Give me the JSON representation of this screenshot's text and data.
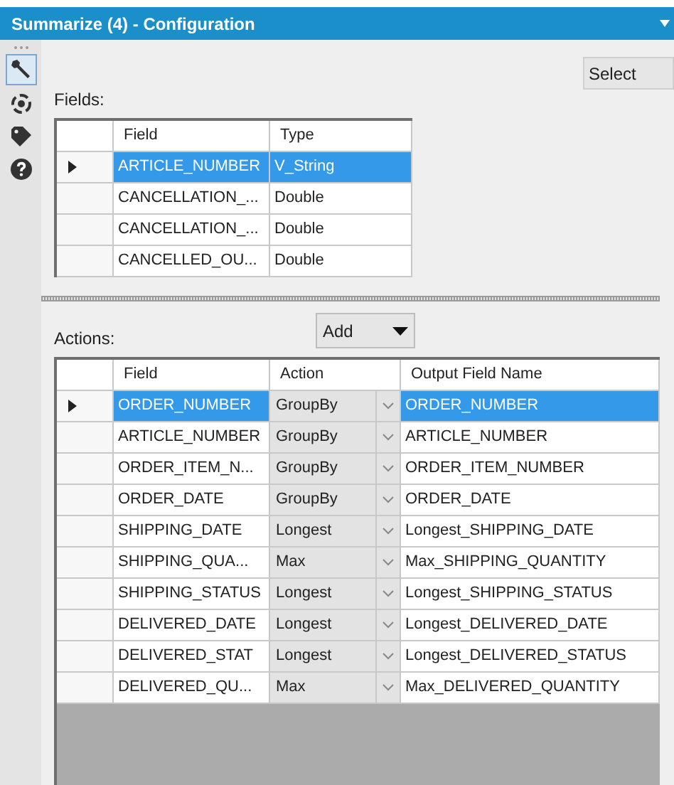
{
  "window": {
    "title": "Summarize (4) - Configuration"
  },
  "toolbar": [
    {
      "kind": "wrench",
      "selected": true
    },
    {
      "kind": "target",
      "selected": false
    },
    {
      "kind": "tag",
      "selected": false
    },
    {
      "kind": "help",
      "selected": false
    }
  ],
  "select_button": {
    "label": "Select"
  },
  "fields": {
    "label": "Fields:",
    "columns": [
      "Field",
      "Type"
    ],
    "rows": [
      {
        "field": "ARTICLE_NUMBER",
        "type": "V_String",
        "selected": true
      },
      {
        "field": "CANCELLATION_...",
        "type": "Double",
        "selected": false
      },
      {
        "field": "CANCELLATION_...",
        "type": "Double",
        "selected": false
      },
      {
        "field": "CANCELLED_OU...",
        "type": "Double",
        "selected": false
      }
    ]
  },
  "actions": {
    "label": "Actions:",
    "add_button": {
      "label": "Add"
    },
    "columns": [
      "Field",
      "Action",
      "Output Field Name"
    ],
    "rows": [
      {
        "field": "ORDER_NUMBER",
        "action": "GroupBy",
        "output": "ORDER_NUMBER",
        "selected": true
      },
      {
        "field": "ARTICLE_NUMBER",
        "action": "GroupBy",
        "output": "ARTICLE_NUMBER",
        "selected": false
      },
      {
        "field": "ORDER_ITEM_N...",
        "action": "GroupBy",
        "output": "ORDER_ITEM_NUMBER",
        "selected": false
      },
      {
        "field": "ORDER_DATE",
        "action": "GroupBy",
        "output": "ORDER_DATE",
        "selected": false
      },
      {
        "field": "SHIPPING_DATE",
        "action": "Longest",
        "output": "Longest_SHIPPING_DATE",
        "selected": false
      },
      {
        "field": "SHIPPING_QUA...",
        "action": "Max",
        "output": "Max_SHIPPING_QUANTITY",
        "selected": false
      },
      {
        "field": "SHIPPING_STATUS",
        "action": "Longest",
        "output": "Longest_SHIPPING_STATUS",
        "selected": false
      },
      {
        "field": "DELIVERED_DATE",
        "action": "Longest",
        "output": "Longest_DELIVERED_DATE",
        "selected": false
      },
      {
        "field": "DELIVERED_STAT",
        "action": "Longest",
        "output": "Longest_DELIVERED_STATUS",
        "selected": false
      },
      {
        "field": "DELIVERED_QU...",
        "action": "Max",
        "output": "Max_DELIVERED_QUANTITY",
        "selected": false
      }
    ]
  }
}
